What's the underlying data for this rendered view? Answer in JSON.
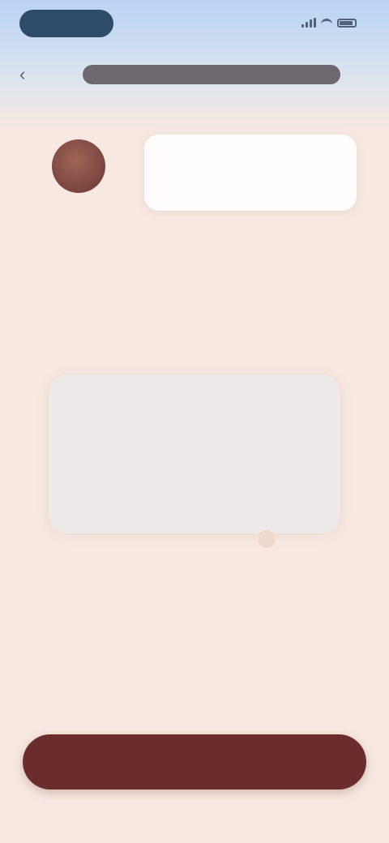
{
  "status_bar": {
    "time": ""
  },
  "header": {
    "title": ""
  },
  "message": {
    "text": ""
  },
  "card": {
    "title": "",
    "subtitle": "",
    "left_label": "",
    "right_label": ""
  },
  "cta": {
    "left_text": "",
    "label": "",
    "right_text": ""
  },
  "colors": {
    "accent": "#6b2c2c",
    "background": "#f7e9e1",
    "header_gradient_top": "#b9d3f3",
    "card": "#efeaea"
  },
  "icons": {
    "back": "chevron-left-icon",
    "pin": "pin-icon",
    "signal": "signal-icon",
    "wifi": "wifi-icon",
    "battery": "battery-icon"
  }
}
